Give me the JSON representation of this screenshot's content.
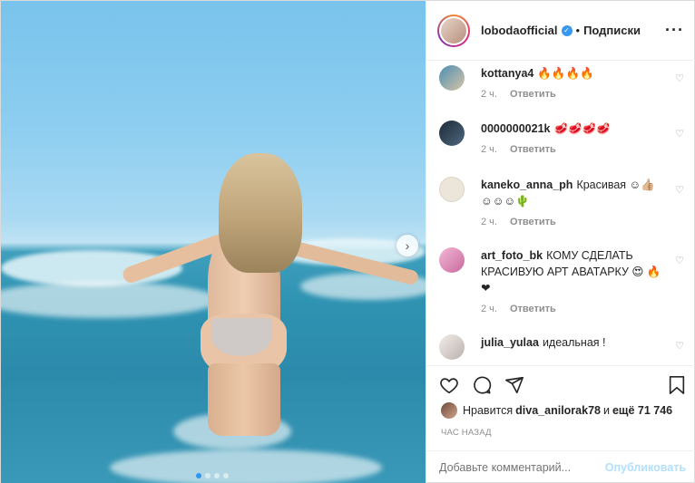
{
  "post": {
    "photo": {
      "alt": "",
      "carousel_dots": 4,
      "active_dot": 0,
      "next_icon": "chevron-right-icon"
    },
    "header": {
      "username": "lobodaofficial",
      "verified": true,
      "separator": "•",
      "follow_label": "Подписки",
      "more_icon": "more-horizontal-icon"
    },
    "comments": [
      {
        "username": "kottanya4",
        "text": "🔥🔥🔥🔥",
        "time": "2 ч.",
        "reply": "Ответить",
        "avatar_color": "#6aa8c7"
      },
      {
        "username": "0000000021k",
        "text": "🥩🥩🥩🥩",
        "time": "2 ч.",
        "reply": "Ответить",
        "avatar_color": "#2b3a4a"
      },
      {
        "username": "kaneko_anna_ph",
        "text": "Красивая ☺👍🏼 ☺☺☺🌵",
        "time": "2 ч.",
        "reply": "Ответить",
        "avatar_color": "#e9e3d7"
      },
      {
        "username": "art_foto_bk",
        "text": "КОМУ СДЕЛАТЬ КРАСИВУЮ АРТ АВАТАРКУ 😍 🔥❤",
        "time": "2 ч.",
        "reply": "Ответить",
        "avatar_color": "#e79ac0"
      },
      {
        "username": "julia_yulaa",
        "text": "идеальная !",
        "time": "",
        "reply": "",
        "avatar_color": "#d9d4d0"
      }
    ],
    "actions": {
      "like_icon": "heart-icon",
      "comment_icon": "comment-icon",
      "share_icon": "send-icon",
      "save_icon": "bookmark-icon"
    },
    "likes": {
      "prefix": "Нравится",
      "user": "diva_anilorak78",
      "joiner": "и",
      "others": "ещё 71 746"
    },
    "timestamp": "ЧАС НАЗАД",
    "add_comment": {
      "placeholder": "Добавьте комментарий...",
      "publish_label": "Опубликовать"
    },
    "colors": {
      "link_disabled": "#b2dffc",
      "verified": "#3897f0",
      "meta": "#8e8e8e",
      "active_dot": "#2f95f6"
    }
  }
}
